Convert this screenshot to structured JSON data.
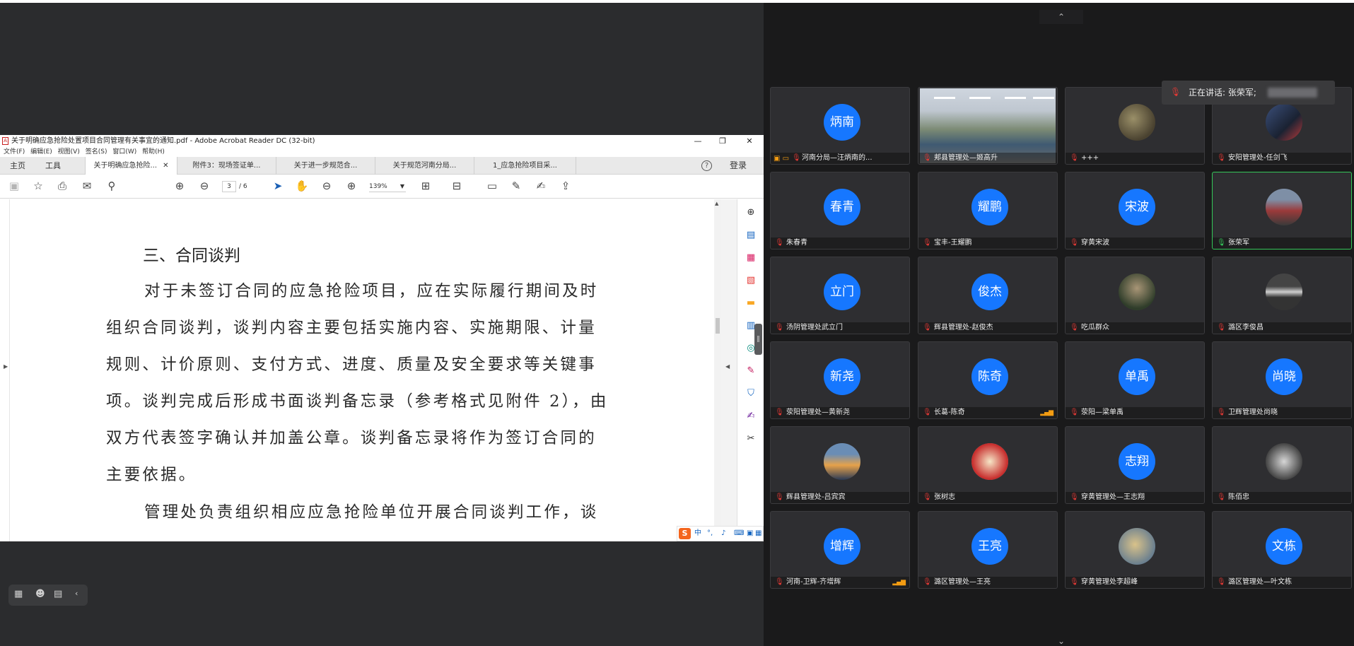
{
  "acrobat": {
    "window_title": "关于明确应急抢险处置项目合同管理有关事宜的通知.pdf - Adobe Acrobat Reader DC (32-bit)",
    "minimize": "—",
    "maximize": "❐",
    "close": "✕",
    "menu": [
      "文件(F)",
      "编辑(E)",
      "视图(V)",
      "签名(S)",
      "窗口(W)",
      "帮助(H)"
    ],
    "tabs": {
      "home": "主页",
      "tools": "工具",
      "docs": [
        "关于明确应急抢险...",
        "附件3：现场签证单...",
        "关于进一步规范合...",
        "关于规范河南分局...",
        "1_应急抢险项目采..."
      ]
    },
    "help_label": "?",
    "login": "登录",
    "page_current": "3",
    "page_total": "/ 6",
    "zoom": "139%",
    "page": {
      "heading": "三、合同谈判",
      "lines": [
        "对于未签订合同的应急抢险项目，应在实际履行期间及时",
        "组织合同谈判，谈判内容主要包括实施内容、实施期限、计量",
        "规则、计价原则、支付方式、进度、质量及安全要求等关键事",
        "项。谈判完成后形成书面谈判备忘录（参考格式见附件 2），由",
        "双方代表签字确认并加盖公章。谈判备忘录将作为签订合同的",
        "主要依据。",
        "管理处负责组织相应应急抢险单位开展合同谈判工作，谈"
      ]
    },
    "ime": {
      "logo": "S",
      "lang": "中"
    }
  },
  "meeting": {
    "speaking_label": "正在讲话: 张荣军;",
    "participants": [
      {
        "avatar_text": "炳南",
        "name": "河南分局—汪炳南的...",
        "avatar_style": "text"
      },
      {
        "avatar_text": "",
        "name": "郏县管理处—姬高升",
        "avatar_style": "video"
      },
      {
        "avatar_text": "",
        "name": "+++",
        "avatar_style": "rock"
      },
      {
        "avatar_text": "",
        "name": "安阳管理处-任剑飞",
        "avatar_style": "city"
      },
      {
        "avatar_text": "春青",
        "name": "朱春青",
        "avatar_style": "text"
      },
      {
        "avatar_text": "耀鹏",
        "name": "宝丰-王耀鹏",
        "avatar_style": "text"
      },
      {
        "avatar_text": "宋波",
        "name": "穿黄宋波",
        "avatar_style": "text"
      },
      {
        "avatar_text": "",
        "name": "张荣军",
        "avatar_style": "road"
      },
      {
        "avatar_text": "立门",
        "name": "汤阴管理处武立门",
        "avatar_style": "text"
      },
      {
        "avatar_text": "俊杰",
        "name": "辉县管理处-赵俊杰",
        "avatar_style": "text"
      },
      {
        "avatar_text": "",
        "name": "吃瓜群众",
        "avatar_style": "forest"
      },
      {
        "avatar_text": "",
        "name": "潞区李俊昌",
        "avatar_style": "car"
      },
      {
        "avatar_text": "新尧",
        "name": "荥阳管理处—黄新尧",
        "avatar_style": "text"
      },
      {
        "avatar_text": "陈奇",
        "name": "长葛-陈奇",
        "avatar_style": "text"
      },
      {
        "avatar_text": "单禹",
        "name": "荥阳—梁单禹",
        "avatar_style": "text"
      },
      {
        "avatar_text": "尚晓",
        "name": "卫辉管理处尚晓",
        "avatar_style": "text"
      },
      {
        "avatar_text": "",
        "name": "辉县管理处-吕宾宾",
        "avatar_style": "sky"
      },
      {
        "avatar_text": "",
        "name": "张树志",
        "avatar_style": "book"
      },
      {
        "avatar_text": "志翔",
        "name": "穿黄管理处—王志翔",
        "avatar_style": "text"
      },
      {
        "avatar_text": "",
        "name": "陈佰忠",
        "avatar_style": "smoke"
      },
      {
        "avatar_text": "增辉",
        "name": "河南-卫辉-齐增辉",
        "avatar_style": "text"
      },
      {
        "avatar_text": "王亮",
        "name": "潞区管理处—王亮",
        "avatar_style": "text"
      },
      {
        "avatar_text": "",
        "name": "穿黄管理处李超峰",
        "avatar_style": "climb"
      },
      {
        "avatar_text": "文栋",
        "name": "潞区管理处—叶文栋",
        "avatar_style": "text"
      }
    ]
  },
  "colors": {
    "avatar_blue": "#1677ff",
    "speaking_green": "#34c759",
    "mic_muted": "#e53935"
  },
  "icons": [
    "pdf-icon",
    "save-icon",
    "star-icon",
    "print-icon",
    "mail-icon",
    "search-icon",
    "up-icon",
    "down-icon",
    "cursor-icon",
    "hand-icon",
    "zoom-out-icon",
    "zoom-in-icon",
    "fit-icon",
    "measure-icon",
    "comment-icon",
    "pen-icon",
    "sign-icon",
    "send-icon",
    "mic-muted-icon",
    "mic-icon",
    "signal-icon"
  ]
}
